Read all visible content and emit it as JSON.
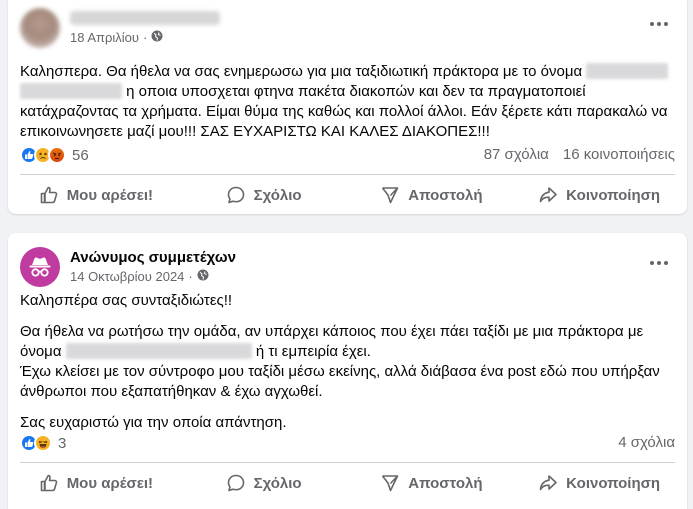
{
  "posts": [
    {
      "author": "",
      "date": "18 Απριλίου",
      "separator": "·",
      "text_parts": [
        "Καλησπερα. Θα ήθελα να σας ενημερωσω για μια ταξιδιωτική πράκτορα με το όνομα",
        "η οποια υποσχεται φτηνα πακέτα διακοπών και δεν τα πραγματοποιεί κατάχραζοντας τα χρήματα. Είμαι θύμα της καθώς και πολλοί άλλοι. Εάν ξέρετε κάτι παρακαλώ να επικοινωνησετε μαζί μου!!! ΣΑΣ ΕΥΧΑΡΙΣΤΩ ΚΑΙ ΚΑΛΕΣ ΔΙΑΚΟΠΕΣ!!!"
      ],
      "reactions": [
        "like-icon",
        "sad-icon",
        "angry-icon"
      ],
      "reaction_count": "56",
      "comments": "87 σχόλια",
      "shares": "16 κοινοποιήσεις"
    },
    {
      "author": "Ανώνυμος συμμετέχων",
      "date": "14 Οκτωβρίου 2024",
      "separator": "·",
      "greeting": "Καλησπέρα σας συνταξιδιώτες!!",
      "para2_a": "Θα ήθελα να ρωτήσω την ομάδα, αν υπάρχει κάποιος που έχει πάει ταξίδι με μια πράκτορα με όνομα",
      "para2_b": "ή τι εμπειρία έχει.",
      "para2_c": "Έχω κλείσει με τον σύντροφο μου ταξίδι μέσω εκείνης, αλλά διάβασα ένα post εδώ που υπήρξαν άνθρωποι που εξαπατήθηκαν & έχω αγχωθεί.",
      "para3": "Σας ευχαριστώ για την οποία απάντηση.",
      "reactions": [
        "like-icon",
        "haha-icon"
      ],
      "reaction_count": "3",
      "comments": "4 σχόλια"
    }
  ],
  "actions": {
    "like": "Μου αρέσει!",
    "comment": "Σχόλιο",
    "send": "Αποστολή",
    "share": "Κοινοποίηση"
  },
  "colors": {
    "background": "#f0f2f5",
    "secondary_text": "#65676b",
    "like_blue": "#1877f2",
    "anon_avatar": "#bf3ba0"
  }
}
